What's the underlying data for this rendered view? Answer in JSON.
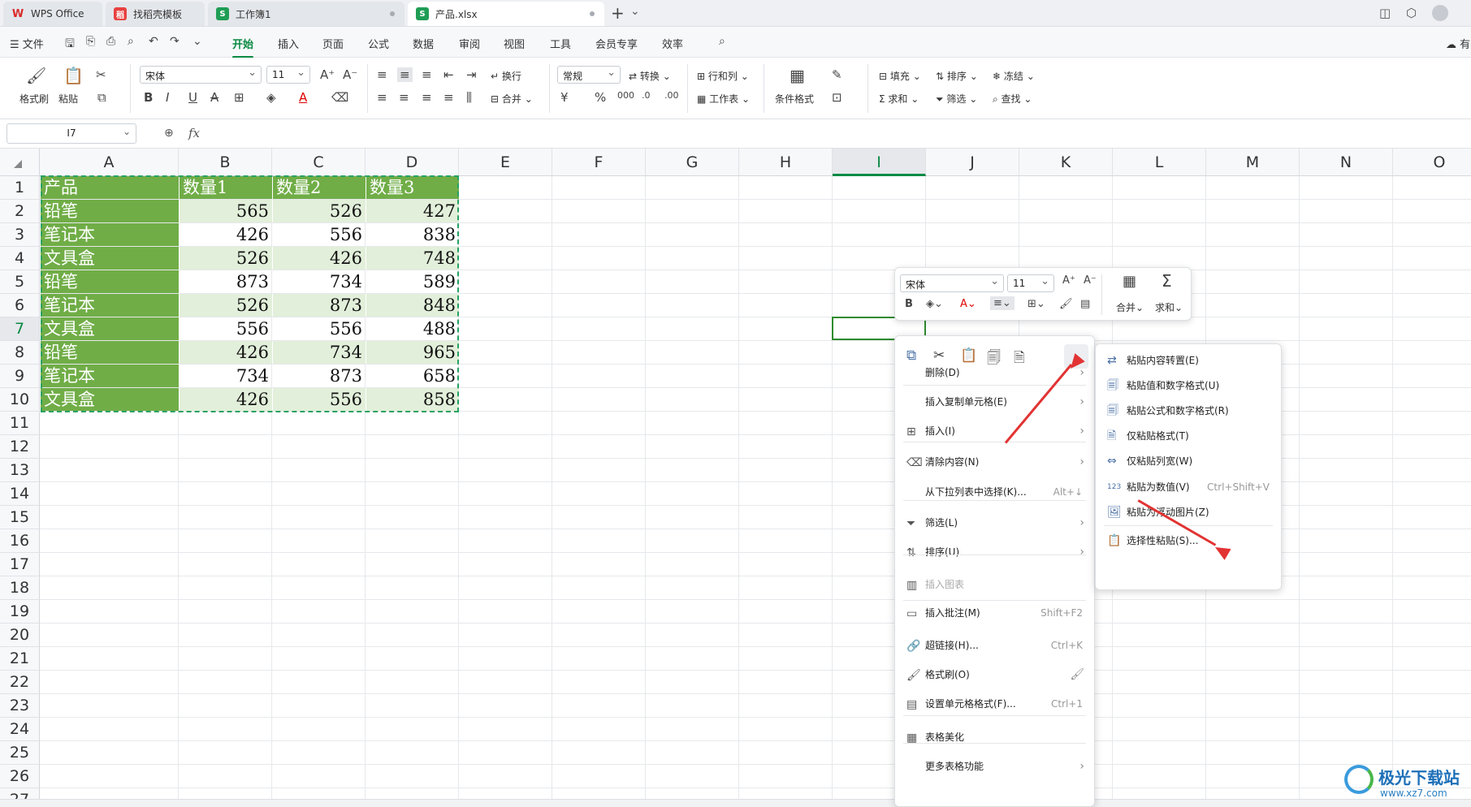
{
  "tabs": [
    {
      "label": "WPS Office",
      "icon_color": "#d92b2b",
      "icon": "W"
    },
    {
      "label": "找稻壳模板",
      "icon_color": "#e84141",
      "icon": "稻"
    },
    {
      "label": "工作簿1",
      "icon_color": "#1f9d55",
      "icon": "S"
    },
    {
      "label": "产品.xlsx",
      "icon_color": "#1f9d55",
      "icon": "S"
    }
  ],
  "menu": {
    "file": "文件",
    "items": [
      "开始",
      "插入",
      "页面",
      "公式",
      "数据",
      "审阅",
      "视图",
      "工具",
      "会员专享",
      "效率"
    ],
    "active": "开始",
    "extra": "有"
  },
  "ribbon": {
    "format_painter": "格式刷",
    "paste": "粘贴",
    "font": "宋体",
    "size": "11",
    "number_format": "常规",
    "wrap": "换行",
    "convert": "转换",
    "row_col": "行和列",
    "merge": "合并",
    "worksheet": "工作表",
    "cond_format": "条件格式",
    "fill": "填充",
    "sort": "排序",
    "freeze": "冻结",
    "sum": "求和",
    "filter": "筛选",
    "find": "查找"
  },
  "formula": {
    "name_box": "I7",
    "fx": "fx"
  },
  "columns": [
    "A",
    "B",
    "C",
    "D",
    "E",
    "F",
    "G",
    "H",
    "I",
    "J",
    "K",
    "L",
    "M",
    "N",
    "O"
  ],
  "rows": [
    "1",
    "2",
    "3",
    "4",
    "5",
    "6",
    "7",
    "8",
    "9",
    "10",
    "11",
    "12",
    "13",
    "14",
    "15",
    "16",
    "17",
    "18",
    "19",
    "20",
    "21",
    "22",
    "23",
    "24",
    "25",
    "26",
    "27"
  ],
  "table": {
    "headers": [
      "产品",
      "数量1",
      "数量2",
      "数量3"
    ],
    "rows": [
      [
        "铅笔",
        "565",
        "526",
        "427"
      ],
      [
        "笔记本",
        "426",
        "556",
        "838"
      ],
      [
        "文具盒",
        "526",
        "426",
        "748"
      ],
      [
        "铅笔",
        "873",
        "734",
        "589"
      ],
      [
        "笔记本",
        "526",
        "873",
        "848"
      ],
      [
        "文具盒",
        "556",
        "556",
        "488"
      ],
      [
        "铅笔",
        "426",
        "734",
        "965"
      ],
      [
        "笔记本",
        "734",
        "873",
        "658"
      ],
      [
        "文具盒",
        "426",
        "556",
        "858"
      ]
    ]
  },
  "mini_toolbar": {
    "font": "宋体",
    "size": "11",
    "merge": "合并",
    "sum": "求和"
  },
  "context_menu": [
    {
      "label": "删除(D)",
      "submenu": true
    },
    {
      "label": "插入复制单元格(E)",
      "submenu": true
    },
    {
      "label": "插入(I)",
      "submenu": true
    },
    {
      "label": "清除内容(N)",
      "submenu": true
    },
    {
      "label": "从下拉列表中选择(K)...",
      "shortcut": "Alt+↓"
    },
    {
      "label": "筛选(L)",
      "submenu": true
    },
    {
      "label": "排序(U)",
      "submenu": true
    },
    {
      "label": "插入图表",
      "disabled": true
    },
    {
      "label": "插入批注(M)",
      "shortcut": "Shift+F2"
    },
    {
      "label": "超链接(H)...",
      "shortcut": "Ctrl+K"
    },
    {
      "label": "格式刷(O)"
    },
    {
      "label": "设置单元格格式(F)...",
      "shortcut": "Ctrl+1"
    },
    {
      "label": "表格美化"
    },
    {
      "label": "更多表格功能",
      "submenu": true
    }
  ],
  "paste_submenu": [
    {
      "label": "粘贴内容转置(E)"
    },
    {
      "label": "粘贴值和数字格式(U)"
    },
    {
      "label": "粘贴公式和数字格式(R)"
    },
    {
      "label": "仅粘贴格式(T)"
    },
    {
      "label": "仅粘贴列宽(W)"
    },
    {
      "label": "粘贴为数值(V)",
      "shortcut": "Ctrl+Shift+V"
    },
    {
      "label": "粘贴为浮动图片(Z)"
    },
    {
      "label": "选择性粘贴(S)..."
    }
  ],
  "watermark": {
    "title": "极光下载站",
    "url": "www.xz7.com"
  },
  "colors": {
    "accent": "#0b8a43",
    "header_fill": "#70ad47",
    "light_fill": "#e2efda",
    "arrow": "#e23333"
  }
}
